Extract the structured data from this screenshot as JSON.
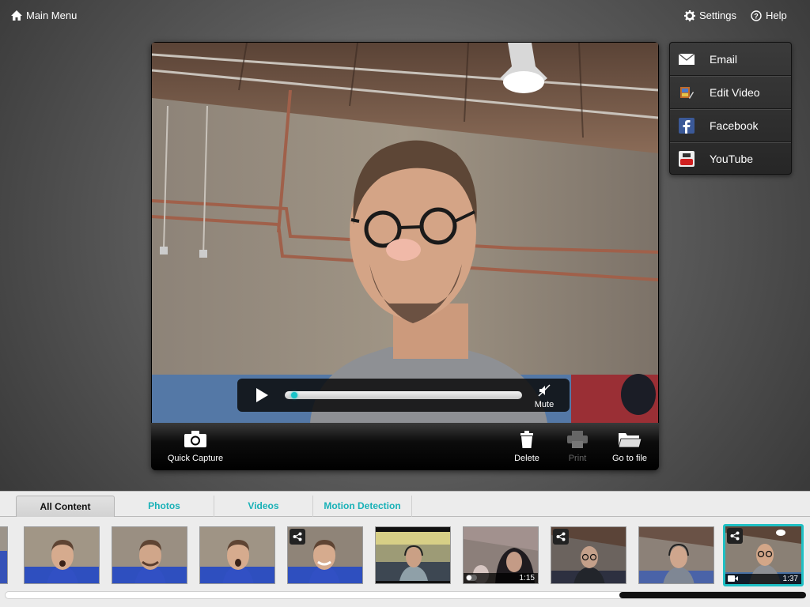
{
  "topbar": {
    "main_menu": "Main Menu",
    "settings": "Settings",
    "help": "Help"
  },
  "player": {
    "progress_fraction": 0.02,
    "mute_label": "Mute"
  },
  "toolbar": {
    "quick_capture": "Quick Capture",
    "delete": "Delete",
    "print": "Print",
    "go_to_file": "Go to file"
  },
  "share_menu": {
    "items": [
      {
        "label": "Email",
        "icon": "envelope-icon"
      },
      {
        "label": "Edit Video",
        "icon": "film-edit-icon"
      },
      {
        "label": "Facebook",
        "icon": "facebook-icon"
      },
      {
        "label": "YouTube",
        "icon": "youtube-icon"
      }
    ]
  },
  "tabs": [
    {
      "label": "All Content",
      "active": true
    },
    {
      "label": "Photos",
      "active": false
    },
    {
      "label": "Videos",
      "active": false
    },
    {
      "label": "Motion Detection",
      "active": false
    }
  ],
  "thumbnails": [
    {
      "type": "photo",
      "shared": false,
      "duration": ""
    },
    {
      "type": "photo",
      "shared": false,
      "duration": ""
    },
    {
      "type": "photo",
      "shared": false,
      "duration": ""
    },
    {
      "type": "photo",
      "shared": false,
      "duration": ""
    },
    {
      "type": "photo",
      "shared": true,
      "duration": ""
    },
    {
      "type": "photo",
      "shared": false,
      "duration": ""
    },
    {
      "type": "video",
      "shared": false,
      "duration": "1:15"
    },
    {
      "type": "photo",
      "shared": true,
      "duration": ""
    },
    {
      "type": "photo",
      "shared": false,
      "duration": ""
    },
    {
      "type": "video",
      "shared": true,
      "duration": "1:37",
      "selected": true
    }
  ],
  "colors": {
    "accent": "#19c3c8",
    "tab_text": "#19b1b7"
  }
}
